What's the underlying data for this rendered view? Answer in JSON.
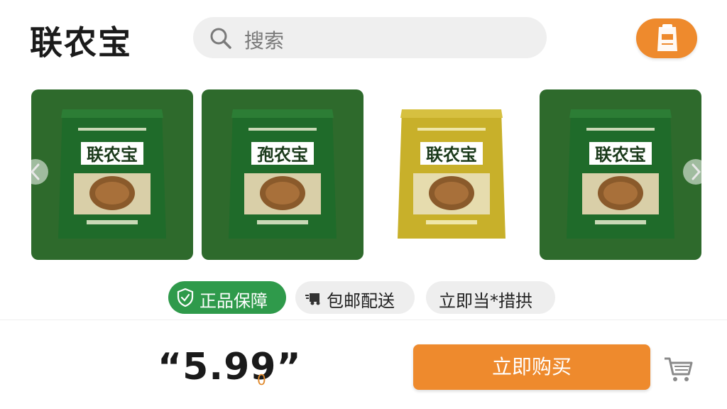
{
  "header": {
    "logo": "联农宝",
    "search_placeholder": "搜索"
  },
  "products": [
    {
      "name": "联农宝",
      "bag_color": "green",
      "card": "green"
    },
    {
      "name": "孢农宝",
      "bag_color": "green",
      "card": "green"
    },
    {
      "name": "联农宝",
      "bag_color": "yellow",
      "card": "none"
    },
    {
      "name": "联农宝",
      "bag_color": "green",
      "card": "green"
    }
  ],
  "tags": [
    {
      "label": "正品保障",
      "icon": "shield-check-icon"
    },
    {
      "label": "包邮配送",
      "icon": "delivery-icon"
    },
    {
      "label": "立即当*措拱",
      "icon": ""
    }
  ],
  "purchase": {
    "price": "“5.99”",
    "price_suffix": "0",
    "buy_label": "立即购买"
  },
  "colors": {
    "accent": "#ee8a2d",
    "card_green": "#2e6a2c",
    "tag_green": "#2f9a4b"
  }
}
